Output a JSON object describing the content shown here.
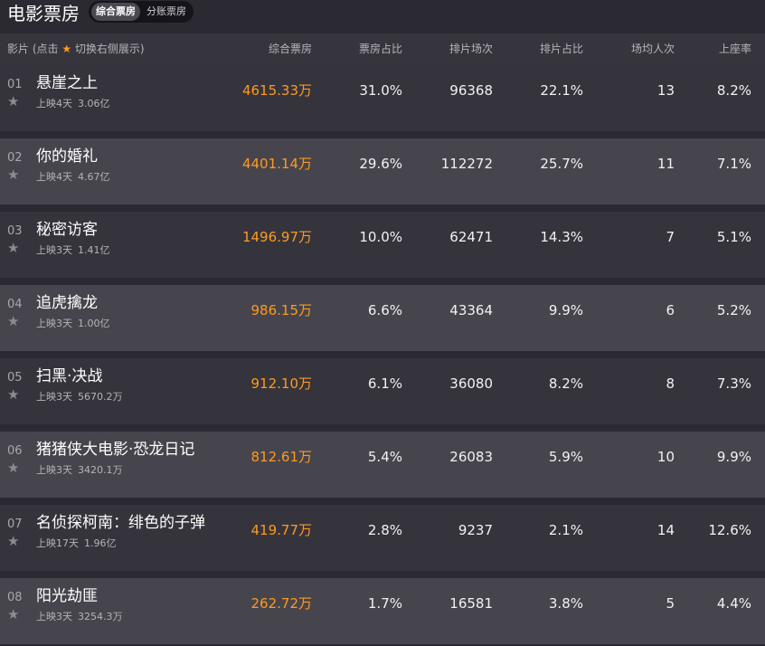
{
  "app": {
    "title": "电影票房",
    "toggle_active": "综合票房",
    "toggle_inactive": "分账票房"
  },
  "header": {
    "film_prefix": "影片 (点击",
    "film_star": "★",
    "film_suffix": "切换右侧展示)",
    "columns": [
      "综合票房",
      "票房占比",
      "排片场次",
      "排片占比",
      "场均人次",
      "上座率"
    ]
  },
  "movies": [
    {
      "rank": "01",
      "title": "悬崖之上",
      "days": "上映4天",
      "total": "3.06亿",
      "box": "4615.33万",
      "box_share": "31.0%",
      "shows": "96368",
      "show_share": "22.1%",
      "avg_people": "13",
      "occupancy": "8.2%"
    },
    {
      "rank": "02",
      "title": "你的婚礼",
      "days": "上映4天",
      "total": "4.67亿",
      "box": "4401.14万",
      "box_share": "29.6%",
      "shows": "112272",
      "show_share": "25.7%",
      "avg_people": "11",
      "occupancy": "7.1%"
    },
    {
      "rank": "03",
      "title": "秘密访客",
      "days": "上映3天",
      "total": "1.41亿",
      "box": "1496.97万",
      "box_share": "10.0%",
      "shows": "62471",
      "show_share": "14.3%",
      "avg_people": "7",
      "occupancy": "5.1%"
    },
    {
      "rank": "04",
      "title": "追虎擒龙",
      "days": "上映3天",
      "total": "1.00亿",
      "box": "986.15万",
      "box_share": "6.6%",
      "shows": "43364",
      "show_share": "9.9%",
      "avg_people": "6",
      "occupancy": "5.2%"
    },
    {
      "rank": "05",
      "title": "扫黑·决战",
      "days": "上映3天",
      "total": "5670.2万",
      "box": "912.10万",
      "box_share": "6.1%",
      "shows": "36080",
      "show_share": "8.2%",
      "avg_people": "8",
      "occupancy": "7.3%"
    },
    {
      "rank": "06",
      "title": "猪猪侠大电影·恐龙日记",
      "days": "上映3天",
      "total": "3420.1万",
      "box": "812.61万",
      "box_share": "5.4%",
      "shows": "26083",
      "show_share": "5.9%",
      "avg_people": "10",
      "occupancy": "9.9%"
    },
    {
      "rank": "07",
      "title": "名侦探柯南：绯色的子弹",
      "days": "上映17天",
      "total": "1.96亿",
      "box": "419.77万",
      "box_share": "2.8%",
      "shows": "9237",
      "show_share": "2.1%",
      "avg_people": "14",
      "occupancy": "12.6%"
    },
    {
      "rank": "08",
      "title": "阳光劫匪",
      "days": "上映3天",
      "total": "3254.3万",
      "box": "262.72万",
      "box_share": "1.7%",
      "shows": "16581",
      "show_share": "3.8%",
      "avg_people": "5",
      "occupancy": "4.4%"
    }
  ],
  "colors": {
    "accent_orange": "#ff9a1f",
    "row_dark": "#35343c",
    "row_light": "#46454d",
    "header_bg": "#36353d"
  },
  "icons": {
    "favorite": "star-icon"
  }
}
